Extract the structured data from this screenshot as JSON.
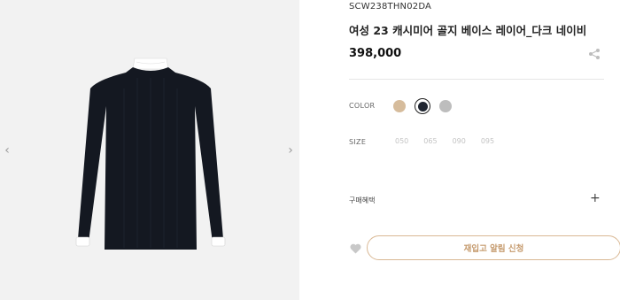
{
  "gallery": {
    "prev_icon": "chevron-left-icon",
    "next_icon": "chevron-right-icon"
  },
  "product": {
    "sku": "SCW238THN02DA",
    "title": "여성 23 캐시미어 골지 베이스 레이어_다크 네이비",
    "price": "398,000"
  },
  "options": {
    "color_label": "COLOR",
    "colors": [
      {
        "name": "beige",
        "hex": "#d6bc9c"
      },
      {
        "name": "dark-navy",
        "hex": "#1f2530",
        "selected": true
      },
      {
        "name": "grey",
        "hex": "#bdbdbd"
      }
    ],
    "size_label": "SIZE",
    "sizes": [
      "050",
      "065",
      "090",
      "095"
    ]
  },
  "benefits": {
    "label": "구매혜택"
  },
  "actions": {
    "restock_label": "재입고 알림 신청"
  },
  "colors": {
    "accent": "#c59a6d",
    "accent_border": "#d9b894",
    "gallery_bg": "#f2f2f2"
  }
}
